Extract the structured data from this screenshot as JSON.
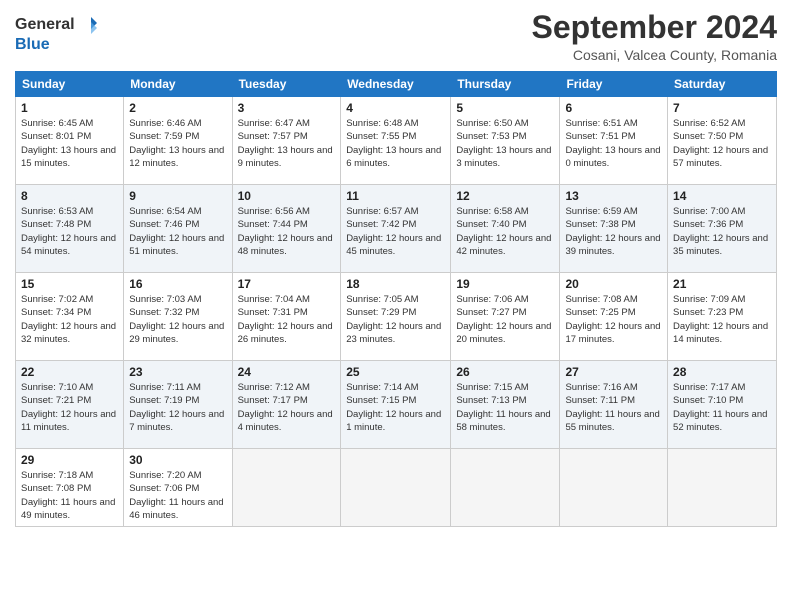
{
  "header": {
    "logo_line1": "General",
    "logo_line2": "Blue",
    "month_title": "September 2024",
    "subtitle": "Cosani, Valcea County, Romania"
  },
  "weekdays": [
    "Sunday",
    "Monday",
    "Tuesday",
    "Wednesday",
    "Thursday",
    "Friday",
    "Saturday"
  ],
  "weeks": [
    [
      {
        "day": "1",
        "sunrise": "6:45 AM",
        "sunset": "8:01 PM",
        "daylight": "13 hours and 15 minutes."
      },
      {
        "day": "2",
        "sunrise": "6:46 AM",
        "sunset": "7:59 PM",
        "daylight": "13 hours and 12 minutes."
      },
      {
        "day": "3",
        "sunrise": "6:47 AM",
        "sunset": "7:57 PM",
        "daylight": "13 hours and 9 minutes."
      },
      {
        "day": "4",
        "sunrise": "6:48 AM",
        "sunset": "7:55 PM",
        "daylight": "13 hours and 6 minutes."
      },
      {
        "day": "5",
        "sunrise": "6:50 AM",
        "sunset": "7:53 PM",
        "daylight": "13 hours and 3 minutes."
      },
      {
        "day": "6",
        "sunrise": "6:51 AM",
        "sunset": "7:51 PM",
        "daylight": "13 hours and 0 minutes."
      },
      {
        "day": "7",
        "sunrise": "6:52 AM",
        "sunset": "7:50 PM",
        "daylight": "12 hours and 57 minutes."
      }
    ],
    [
      {
        "day": "8",
        "sunrise": "6:53 AM",
        "sunset": "7:48 PM",
        "daylight": "12 hours and 54 minutes."
      },
      {
        "day": "9",
        "sunrise": "6:54 AM",
        "sunset": "7:46 PM",
        "daylight": "12 hours and 51 minutes."
      },
      {
        "day": "10",
        "sunrise": "6:56 AM",
        "sunset": "7:44 PM",
        "daylight": "12 hours and 48 minutes."
      },
      {
        "day": "11",
        "sunrise": "6:57 AM",
        "sunset": "7:42 PM",
        "daylight": "12 hours and 45 minutes."
      },
      {
        "day": "12",
        "sunrise": "6:58 AM",
        "sunset": "7:40 PM",
        "daylight": "12 hours and 42 minutes."
      },
      {
        "day": "13",
        "sunrise": "6:59 AM",
        "sunset": "7:38 PM",
        "daylight": "12 hours and 39 minutes."
      },
      {
        "day": "14",
        "sunrise": "7:00 AM",
        "sunset": "7:36 PM",
        "daylight": "12 hours and 35 minutes."
      }
    ],
    [
      {
        "day": "15",
        "sunrise": "7:02 AM",
        "sunset": "7:34 PM",
        "daylight": "12 hours and 32 minutes."
      },
      {
        "day": "16",
        "sunrise": "7:03 AM",
        "sunset": "7:32 PM",
        "daylight": "12 hours and 29 minutes."
      },
      {
        "day": "17",
        "sunrise": "7:04 AM",
        "sunset": "7:31 PM",
        "daylight": "12 hours and 26 minutes."
      },
      {
        "day": "18",
        "sunrise": "7:05 AM",
        "sunset": "7:29 PM",
        "daylight": "12 hours and 23 minutes."
      },
      {
        "day": "19",
        "sunrise": "7:06 AM",
        "sunset": "7:27 PM",
        "daylight": "12 hours and 20 minutes."
      },
      {
        "day": "20",
        "sunrise": "7:08 AM",
        "sunset": "7:25 PM",
        "daylight": "12 hours and 17 minutes."
      },
      {
        "day": "21",
        "sunrise": "7:09 AM",
        "sunset": "7:23 PM",
        "daylight": "12 hours and 14 minutes."
      }
    ],
    [
      {
        "day": "22",
        "sunrise": "7:10 AM",
        "sunset": "7:21 PM",
        "daylight": "12 hours and 11 minutes."
      },
      {
        "day": "23",
        "sunrise": "7:11 AM",
        "sunset": "7:19 PM",
        "daylight": "12 hours and 7 minutes."
      },
      {
        "day": "24",
        "sunrise": "7:12 AM",
        "sunset": "7:17 PM",
        "daylight": "12 hours and 4 minutes."
      },
      {
        "day": "25",
        "sunrise": "7:14 AM",
        "sunset": "7:15 PM",
        "daylight": "12 hours and 1 minute."
      },
      {
        "day": "26",
        "sunrise": "7:15 AM",
        "sunset": "7:13 PM",
        "daylight": "11 hours and 58 minutes."
      },
      {
        "day": "27",
        "sunrise": "7:16 AM",
        "sunset": "7:11 PM",
        "daylight": "11 hours and 55 minutes."
      },
      {
        "day": "28",
        "sunrise": "7:17 AM",
        "sunset": "7:10 PM",
        "daylight": "11 hours and 52 minutes."
      }
    ],
    [
      {
        "day": "29",
        "sunrise": "7:18 AM",
        "sunset": "7:08 PM",
        "daylight": "11 hours and 49 minutes."
      },
      {
        "day": "30",
        "sunrise": "7:20 AM",
        "sunset": "7:06 PM",
        "daylight": "11 hours and 46 minutes."
      },
      null,
      null,
      null,
      null,
      null
    ]
  ]
}
